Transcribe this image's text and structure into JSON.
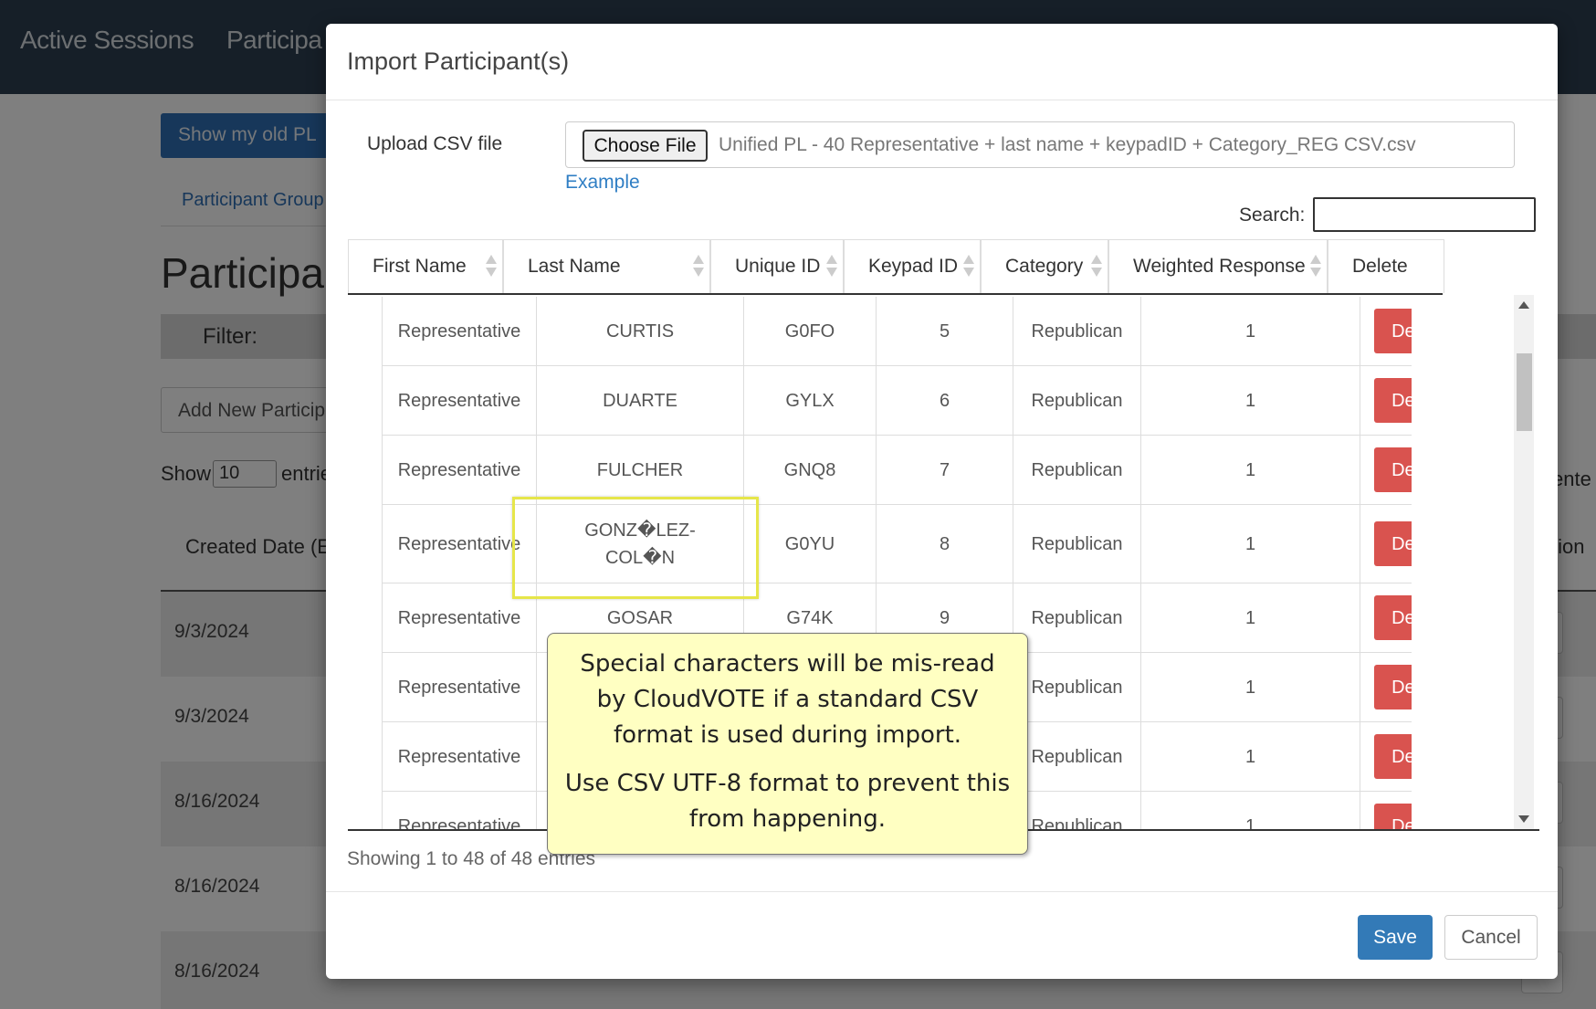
{
  "background": {
    "nav": [
      "Active Sessions",
      "Participa"
    ],
    "old_pl_button": "Show my old PL",
    "tab": "Participant Group",
    "heading": "Participan",
    "filter_label": "Filter:",
    "add_button": "Add New Participa",
    "show_label": "Show",
    "show_value": "10",
    "entries_label": "entrie",
    "right_entries": "ente",
    "created_header": "Created Date (ET",
    "right_header": "tion",
    "dates": [
      "9/3/2024",
      "9/3/2024",
      "8/16/2024",
      "8/16/2024",
      "8/16/2024"
    ]
  },
  "modal": {
    "title": "Import Participant(s)",
    "upload_label": "Upload CSV file",
    "choose_file": "Choose File",
    "file_name": "Unified PL - 40 Representative + last name + keypadID + Category_REG CSV.csv",
    "example_link": "Example",
    "search_label": "Search:",
    "search_value": "",
    "columns": [
      "First Name",
      "Last Name",
      "Unique ID",
      "Keypad ID",
      "Category",
      "Weighted Response",
      "Delete"
    ],
    "rows": [
      {
        "first": "Representative",
        "last": "CURTIS",
        "uid": "G0FO",
        "keypad": "5",
        "category": "Republican",
        "weight": "1",
        "action": "Delete"
      },
      {
        "first": "Representative",
        "last": "DUARTE",
        "uid": "GYLX",
        "keypad": "6",
        "category": "Republican",
        "weight": "1",
        "action": "Delete"
      },
      {
        "first": "Representative",
        "last": "FULCHER",
        "uid": "GNQ8",
        "keypad": "7",
        "category": "Republican",
        "weight": "1",
        "action": "Delete"
      },
      {
        "first": "Representative",
        "last": "GONZ�LEZ-COL�N",
        "uid": "G0YU",
        "keypad": "8",
        "category": "Republican",
        "weight": "1",
        "action": "Delete"
      },
      {
        "first": "Representative",
        "last": "GOSAR",
        "uid": "G74K",
        "keypad": "9",
        "category": "Republican",
        "weight": "1",
        "action": "Delete"
      },
      {
        "first": "Representative",
        "last": "",
        "uid": "",
        "keypad": "",
        "category": "Republican",
        "weight": "1",
        "action": "Delete"
      },
      {
        "first": "Representative",
        "last": "",
        "uid": "",
        "keypad": "",
        "category": "Republican",
        "weight": "1",
        "action": "Delete"
      },
      {
        "first": "Representative",
        "last": "",
        "uid": "",
        "keypad": "",
        "category": "Republican",
        "weight": "1",
        "action": "Delete"
      }
    ],
    "showing_text": "Showing 1 to 48 of 48 entries",
    "save_button": "Save",
    "cancel_button": "Cancel"
  },
  "callout": {
    "line1": "Special characters will be mis-read by CloudVOTE if a standard CSV format is used during import.",
    "line2": "Use CSV UTF-8 format to prevent this from happening."
  },
  "colors": {
    "nav_bg": "#2c3e50",
    "primary": "#337ab7",
    "danger": "#d9534f",
    "highlight": "#e6e64a",
    "callout_bg": "#ffffc2"
  }
}
